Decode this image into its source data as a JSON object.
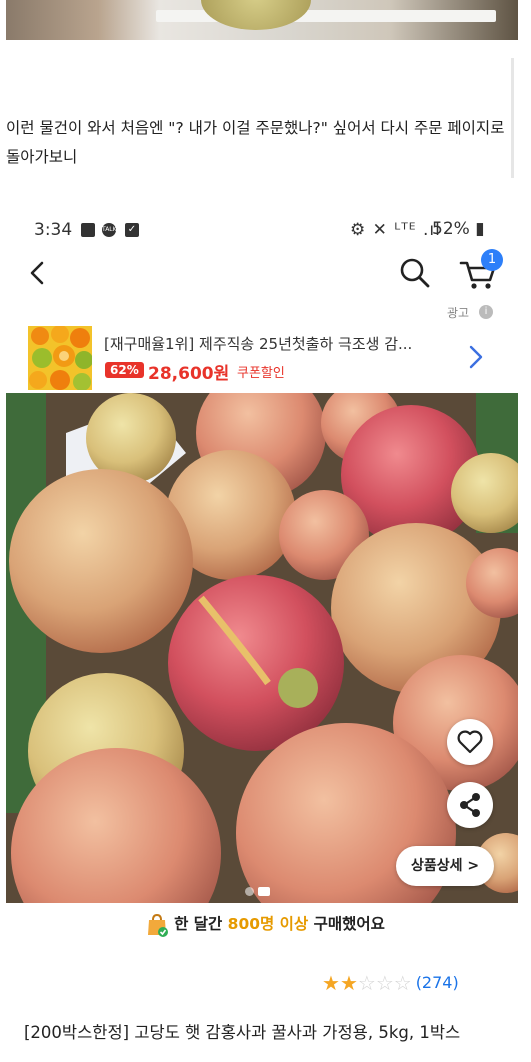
{
  "caption": "이런 물건이 와서 처음엔 \"? 내가 이걸 주문했나?\" 싶어서 다시 주문 페이지로 돌아가보니",
  "status_bar": {
    "time": "3:34",
    "signal_text": "⚙ ✕ ᴸᵀᴱ .ıl",
    "battery": "52%"
  },
  "header": {
    "back_icon": "back-arrow-icon",
    "search_icon": "search-icon",
    "cart_icon": "cart-icon",
    "cart_count": "1"
  },
  "ad": {
    "label": "광고",
    "title": "[재구매율1위] 제주직송 25년첫출하 극조생 감...",
    "discount": "62%",
    "price": "28,600원",
    "coupon": "쿠폰할인"
  },
  "image_actions": {
    "detail_label": "상품상세 >",
    "wishlist_icon": "heart-icon",
    "share_icon": "share-icon"
  },
  "purchase_info": {
    "prefix": "한 달간 ",
    "highlight": "800명 이상",
    "suffix": " 구매했어요"
  },
  "rating": {
    "stars": 2,
    "max_stars": 5,
    "review_count": "(274)"
  },
  "product_title": "[200박스한정] 고당도 햇 감홍사과 꿀사과 가정용, 5kg, 1박스",
  "colors": {
    "accent_red": "#e8332a",
    "accent_blue": "#2d7ff9",
    "highlight_orange": "#e69a00",
    "star": "#f5a623"
  }
}
